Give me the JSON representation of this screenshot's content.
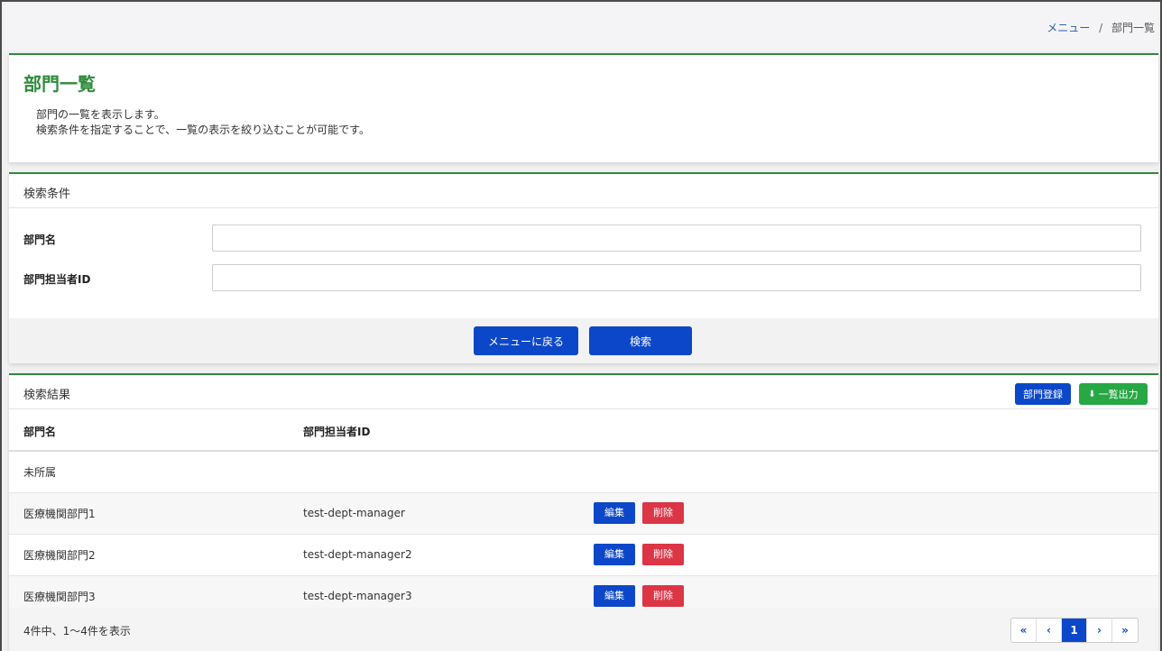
{
  "breadcrumb": {
    "menu": "メニュー",
    "separator": "/",
    "current": "部門一覧"
  },
  "intro": {
    "title": "部門一覧",
    "desc1": "部門の一覧を表示します。",
    "desc2": "検索条件を指定することで、一覧の表示を絞り込むことが可能です。"
  },
  "search": {
    "header": "検索条件",
    "dept_name_label": "部門名",
    "dept_name_value": "",
    "manager_id_label": "部門担当者ID",
    "manager_id_value": "",
    "back_button": "メニューに戻る",
    "search_button": "検索"
  },
  "results": {
    "header": "検索結果",
    "register_button": "部門登録",
    "export_button": "一覧出力",
    "columns": [
      "部門名",
      "部門担当者ID"
    ],
    "rows": [
      {
        "name": "未所属",
        "manager": ""
      },
      {
        "name": "医療機関部門1",
        "manager": "test-dept-manager",
        "edit": "編集",
        "delete": "削除"
      },
      {
        "name": "医療機関部門2",
        "manager": "test-dept-manager2",
        "edit": "編集",
        "delete": "削除"
      },
      {
        "name": "医療機関部門3",
        "manager": "test-dept-manager3",
        "edit": "編集",
        "delete": "削除"
      }
    ],
    "count_text": "4件中、1〜4件を表示",
    "pager": {
      "first": "«",
      "prev": "‹",
      "current_page": "1",
      "next": "›",
      "last": "»"
    }
  },
  "colors": {
    "accent": "#2e8b3a",
    "primary": "#0d47c9",
    "danger": "#dc3545",
    "success": "#28a745"
  }
}
